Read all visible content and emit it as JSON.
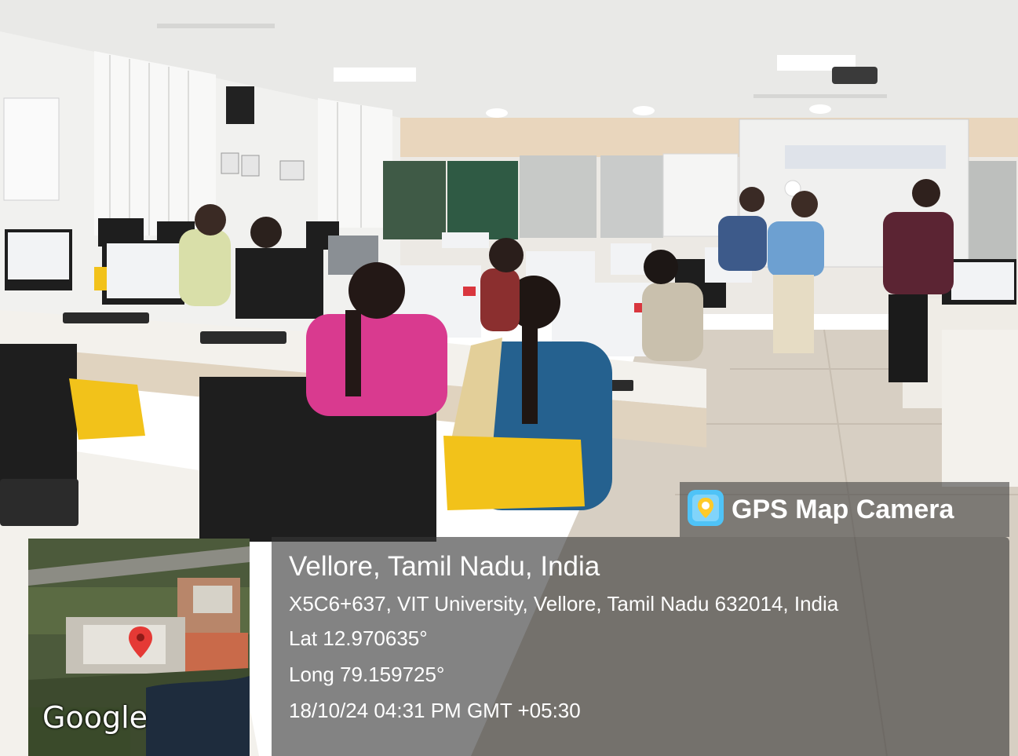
{
  "badge": {
    "app_name": "GPS Map Camera",
    "icon": "gps-map-camera-app-icon"
  },
  "location": {
    "title": "Vellore, Tamil Nadu, India",
    "address": "X5C6+637, VIT University, Vellore, Tamil Nadu 632014, India",
    "latitude": "Lat 12.970635°",
    "longitude": "Long 79.159725°",
    "datetime": "18/10/24 04:31 PM GMT +05:30"
  },
  "map": {
    "provider": "Google",
    "pin_icon": "map-pin-icon",
    "pin_color": "#e53935"
  },
  "colors": {
    "overlay": "#3a3a3a",
    "chair_yellow": "#f2c21a",
    "text": "#ffffff"
  }
}
